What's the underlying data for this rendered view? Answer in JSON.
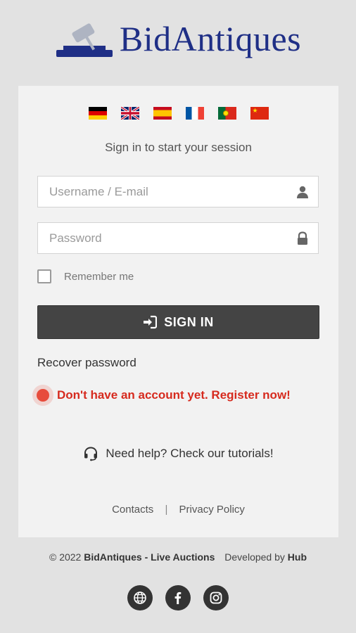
{
  "brand": {
    "name": "BidAntiques",
    "color": "#1f2f86"
  },
  "languages": [
    {
      "code": "de",
      "name": "German"
    },
    {
      "code": "en",
      "name": "English"
    },
    {
      "code": "es",
      "name": "Spanish"
    },
    {
      "code": "fr",
      "name": "French"
    },
    {
      "code": "pt",
      "name": "Portuguese"
    },
    {
      "code": "cn",
      "name": "Chinese"
    }
  ],
  "login": {
    "subtitle": "Sign in to start your session",
    "username_placeholder": "Username / E-mail",
    "username_value": "",
    "password_placeholder": "Password",
    "password_value": "",
    "remember_label": "Remember me",
    "remember_checked": false,
    "signin_label": "SIGN IN",
    "recover_label": "Recover password",
    "register_label": "Don't have an account yet. Register now!",
    "help_label": "Need help? Check our tutorials!"
  },
  "card_footer": {
    "contacts": "Contacts",
    "separator": "|",
    "privacy": "Privacy Policy"
  },
  "footer": {
    "copyright_prefix": "© 2022",
    "company": "BidAntiques - Live Auctions",
    "developed_by": "Developed by",
    "developer": "Hub"
  },
  "social": [
    {
      "icon": "globe-icon"
    },
    {
      "icon": "facebook-icon"
    },
    {
      "icon": "instagram-icon"
    }
  ],
  "colors": {
    "accent_dark": "#444444",
    "register_red": "#d62a1e",
    "dot_red": "#e74c3c"
  }
}
